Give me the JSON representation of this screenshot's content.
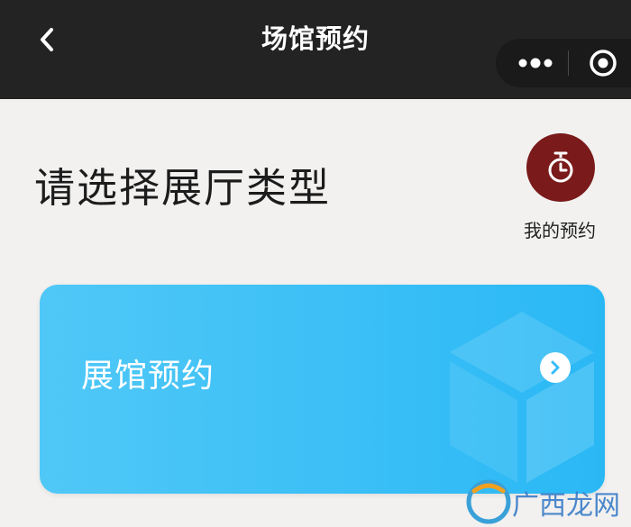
{
  "header": {
    "title": "场馆预约",
    "back_icon": "chevron-left-icon",
    "more_icon": "more-dots-icon",
    "close_icon": "target-close-icon"
  },
  "main": {
    "heading": "请选择展厅类型",
    "my_booking": {
      "label": "我的预约",
      "icon": "timer-icon"
    },
    "cards": [
      {
        "label": "展馆预约",
        "arrow_icon": "chevron-right-circle-icon"
      }
    ]
  },
  "colors": {
    "topbar": "#232323",
    "background": "#f2f1f0",
    "accent_booking": "#7a1a1a",
    "card_blue": "#36bcf6"
  },
  "watermark": {
    "text": "广西龙网"
  }
}
